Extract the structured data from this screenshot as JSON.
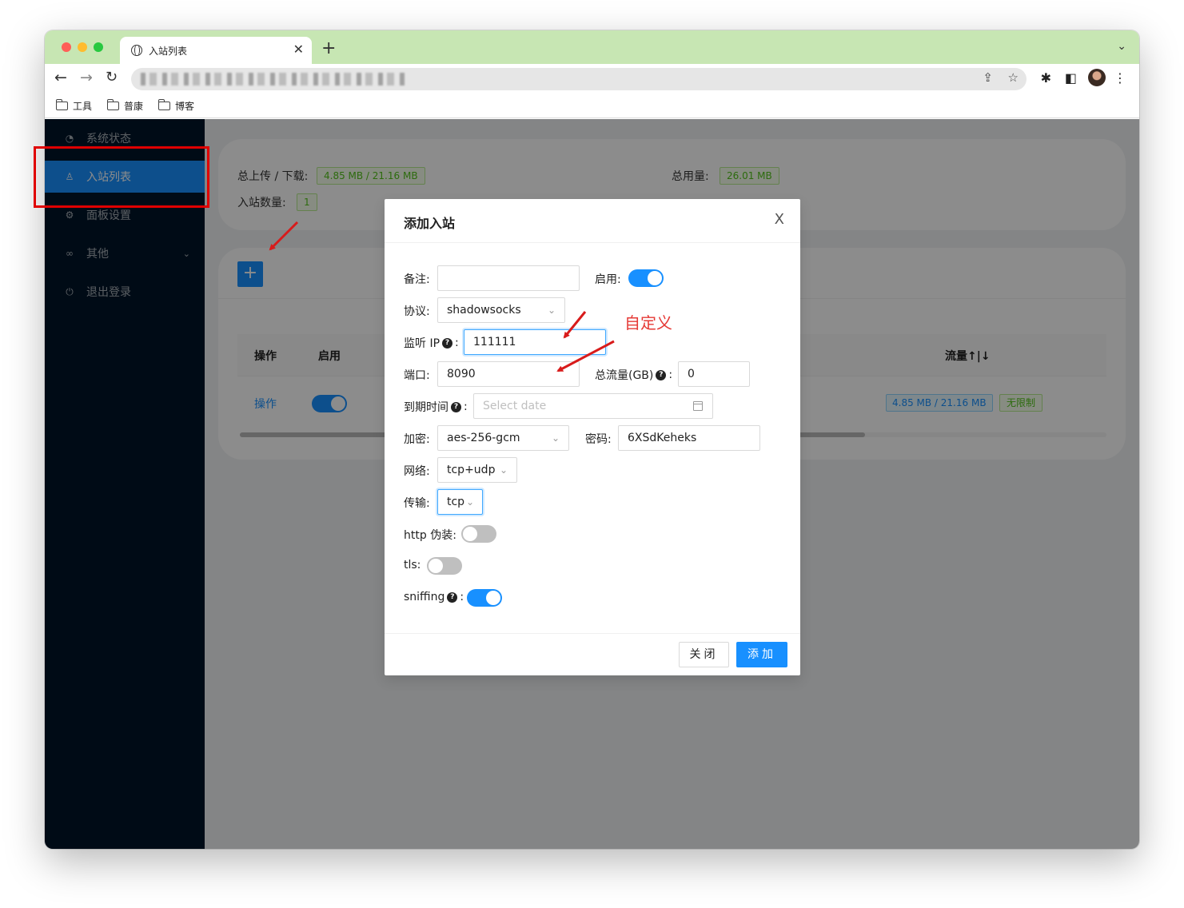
{
  "browser": {
    "tab_title": "入站列表",
    "new_tab": "+",
    "tab_close": "✕",
    "bookmarks": [
      "工具",
      "普康",
      "博客"
    ]
  },
  "sidebar": {
    "items": [
      {
        "label": "系统状态",
        "icon": "dashboard-icon"
      },
      {
        "label": "入站列表",
        "icon": "user-icon"
      },
      {
        "label": "面板设置",
        "icon": "setting-icon"
      },
      {
        "label": "其他",
        "icon": "link-icon"
      },
      {
        "label": "退出登录",
        "icon": "logout-icon"
      }
    ]
  },
  "stats": {
    "upload_download_label": "总上传 / 下载:",
    "upload_download_value": "4.85 MB / 21.16 MB",
    "total_usage_label": "总用量:",
    "total_usage_value": "26.01 MB",
    "inbound_count_label": "入站数量:",
    "inbound_count_value": "1"
  },
  "table": {
    "headers": {
      "action": "操作",
      "enable": "启用",
      "traffic": "流量↑|↓"
    },
    "row": {
      "action": "操作",
      "enabled": true,
      "traffic": "4.85 MB / 21.16 MB",
      "limit": "无限制"
    }
  },
  "modal": {
    "title": "添加入站",
    "close_icon": "X",
    "fields": {
      "remark_label": "备注:",
      "remark_value": "",
      "enable_label": "启用:",
      "protocol_label": "协议:",
      "protocol_value": "shadowsocks",
      "listen_ip_label": "监听 IP",
      "listen_ip_value": "111111",
      "port_label": "端口:",
      "port_value": "8090",
      "total_traffic_label": "总流量(GB)",
      "total_traffic_value": "0",
      "expiry_label": "到期时间",
      "expiry_placeholder": "Select date",
      "encryption_label": "加密:",
      "encryption_value": "aes-256-gcm",
      "password_label": "密码:",
      "password_value": "6XSdKeheks",
      "network_label": "网络:",
      "network_value": "tcp+udp",
      "transport_label": "传输:",
      "transport_value": "tcp",
      "http_camouflage_label": "http 伪装:",
      "tls_label": "tls:",
      "sniffing_label": "sniffing"
    },
    "toggles": {
      "enable": true,
      "http_camouflage": false,
      "tls": false,
      "sniffing": true
    },
    "buttons": {
      "close": "关闭",
      "add": "添加"
    }
  },
  "annotation": {
    "custom_text": "自定义",
    "color": "#e53935"
  },
  "colors": {
    "primary": "#1890ff",
    "sidebar": "#001529",
    "tab_bar": "#c7e6b3"
  }
}
